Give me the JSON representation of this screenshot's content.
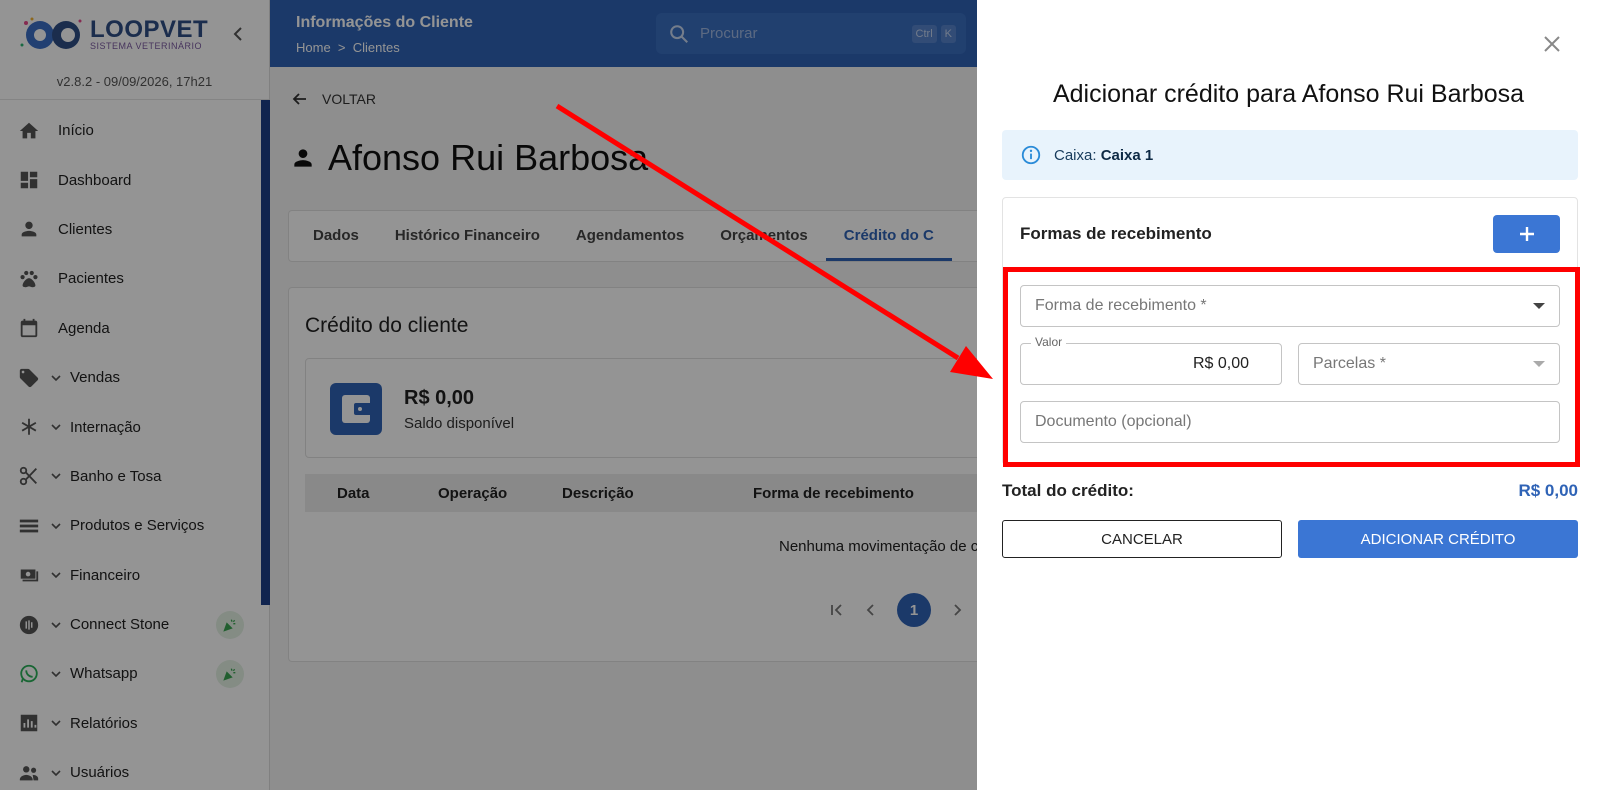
{
  "sidebar": {
    "logo_text": "LOOPVET",
    "logo_sub": "SISTEMA VETERINÁRIO",
    "version": "v2.8.2 - 09/09/2026, 17h21",
    "items": [
      {
        "label": "Início",
        "icon": "home-icon"
      },
      {
        "label": "Dashboard",
        "icon": "dashboard-icon"
      },
      {
        "label": "Clientes",
        "icon": "person-icon"
      },
      {
        "label": "Pacientes",
        "icon": "paw-icon"
      },
      {
        "label": "Agenda",
        "icon": "calendar-icon"
      },
      {
        "label": "Vendas",
        "icon": "tag-icon"
      },
      {
        "label": "Internação",
        "icon": "asterisk-icon"
      },
      {
        "label": "Banho e Tosa",
        "icon": "scissors-icon"
      },
      {
        "label": "Produtos e Serviços",
        "icon": "list-icon"
      },
      {
        "label": "Financeiro",
        "icon": "money-icon"
      },
      {
        "label": "Connect Stone",
        "icon": "nfc-icon"
      },
      {
        "label": "Whatsapp",
        "icon": "whatsapp-icon"
      },
      {
        "label": "Relatórios",
        "icon": "chart-icon"
      },
      {
        "label": "Usuários",
        "icon": "users-icon"
      }
    ]
  },
  "topbar": {
    "title": "Informações do Cliente",
    "crumb_home": "Home",
    "crumb_sep": ">",
    "crumb_current": "Clientes",
    "search_placeholder": "Procurar",
    "kbd_ctrl": "Ctrl",
    "kbd_k": "K"
  },
  "main": {
    "back_label": "VOLTAR",
    "client_name": "Afonso Rui Barbosa",
    "tabs": [
      "Dados",
      "Histórico Financeiro",
      "Agendamentos",
      "Orçamentos",
      "Crédito do C"
    ],
    "active_tab": 4,
    "credit_title": "Crédito do cliente",
    "balance_value": "R$ 0,00",
    "balance_label": "Saldo disponível",
    "table_headers": [
      "Data",
      "Operação",
      "Descrição",
      "Forma de recebimento"
    ],
    "empty_message": "Nenhuma movimentação de c",
    "current_page": "1"
  },
  "drawer": {
    "title": "Adicionar crédito para Afonso Rui Barbosa",
    "info_prefix": "Caixa:",
    "info_value": "Caixa 1",
    "payment_title": "Formas de recebimento",
    "payment_method_placeholder": "Forma de recebimento *",
    "value_label": "Valor",
    "value_amount": "R$ 0,00",
    "installments_placeholder": "Parcelas *",
    "document_placeholder": "Documento (opcional)",
    "total_label": "Total do crédito:",
    "total_value": "R$ 0,00",
    "cancel_label": "CANCELAR",
    "submit_label": "ADICIONAR CRÉDITO"
  },
  "colors": {
    "primary": "#2f63b6",
    "button": "#3b76d4",
    "highlight": "#ff0000",
    "info_bg": "#e8f3fc"
  }
}
